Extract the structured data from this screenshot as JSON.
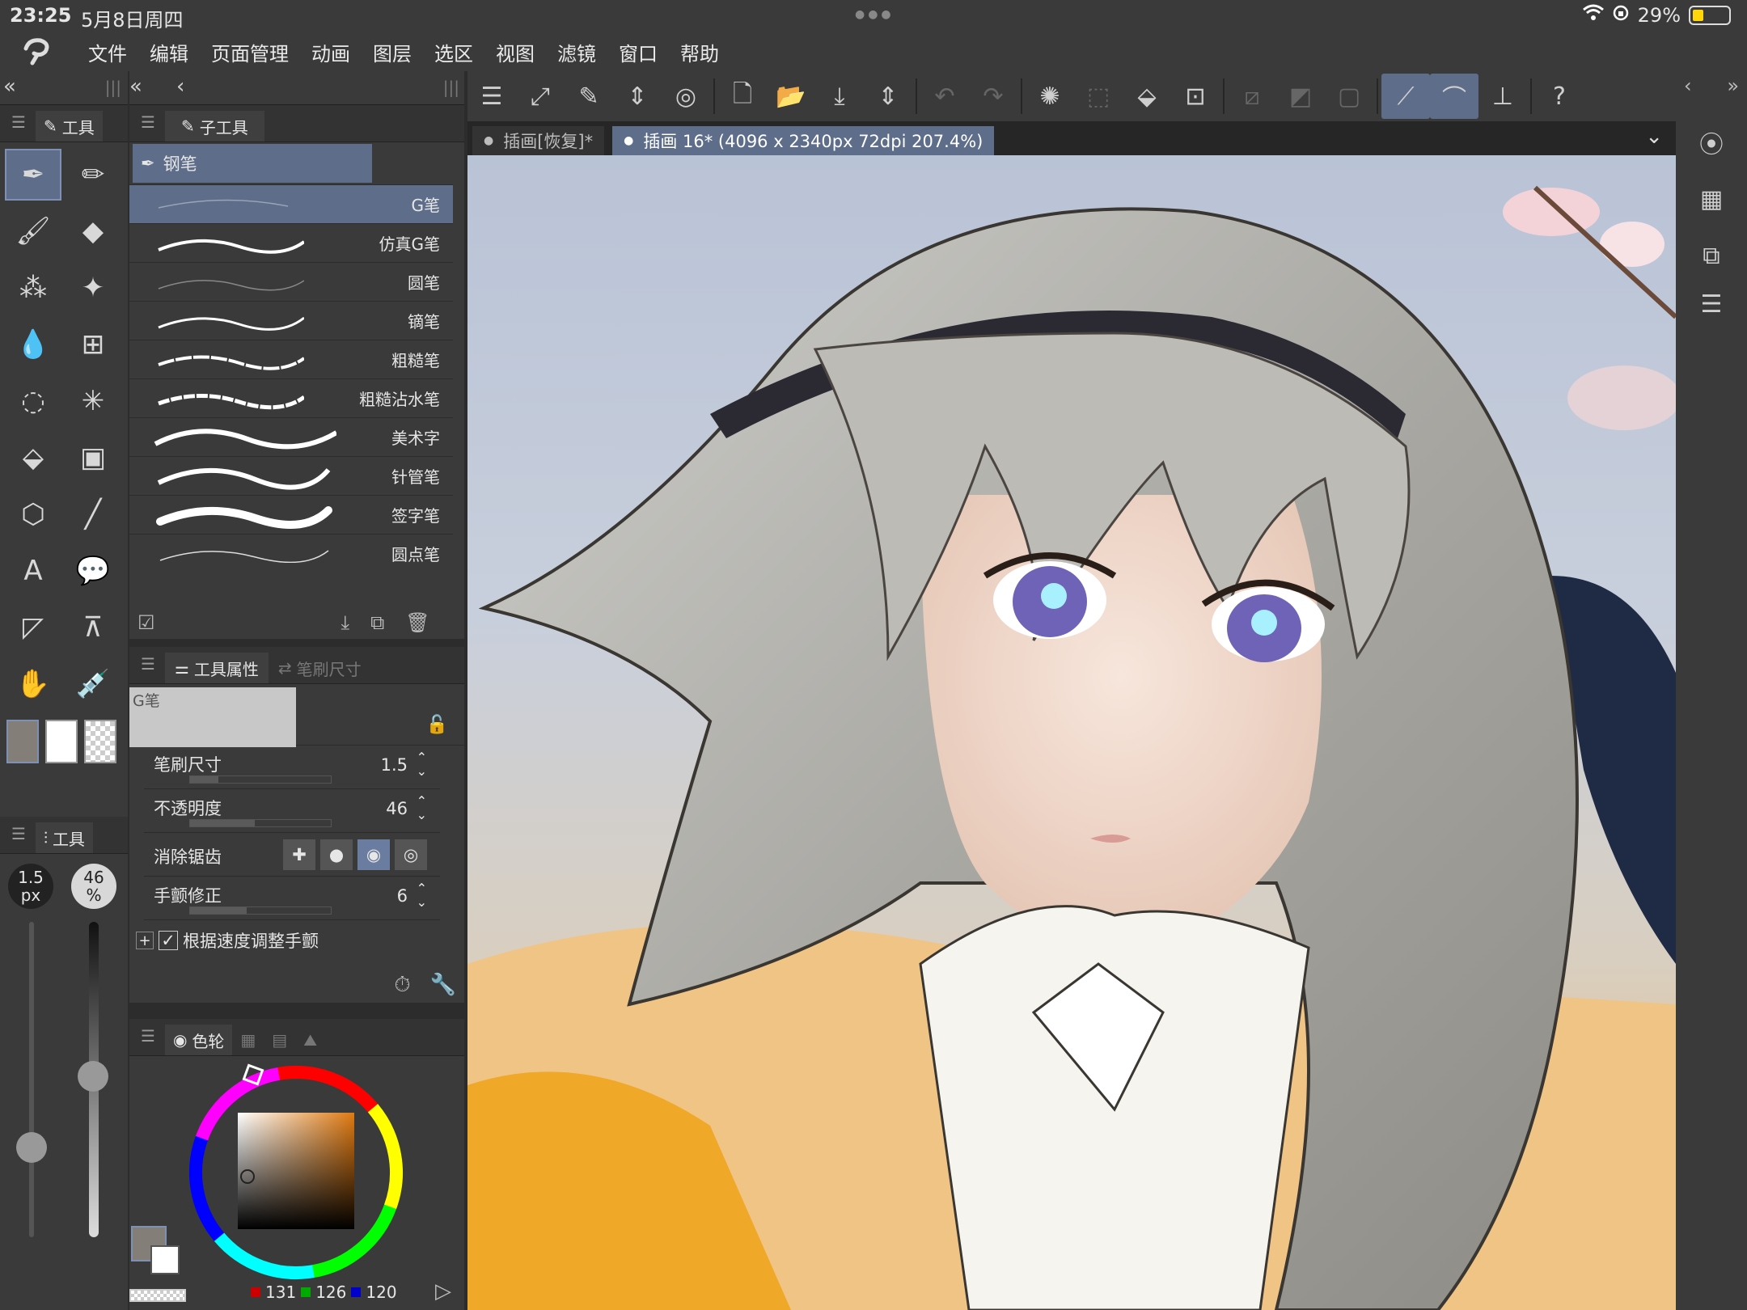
{
  "status": {
    "time": "23:25",
    "date": "5月8日周四",
    "battery": "29%"
  },
  "menu": [
    "文件",
    "编辑",
    "页面管理",
    "动画",
    "图层",
    "选区",
    "视图",
    "滤镜",
    "窗口",
    "帮助"
  ],
  "tool_panel": {
    "title": "工具"
  },
  "subtool_panel": {
    "title": "子工具",
    "group": "钢笔",
    "brushes": [
      "G笔",
      "仿真G笔",
      "圆笔",
      "镝笔",
      "粗糙笔",
      "粗糙沾水笔",
      "美术字",
      "针管笔",
      "签字笔",
      "圆点笔"
    ],
    "selected": "G笔"
  },
  "props": {
    "tab_active": "工具属性",
    "tab_inactive": "笔刷尺寸",
    "preview_label": "G笔",
    "brush_size": {
      "label": "笔刷尺寸",
      "value": "1.5",
      "level": 0.2
    },
    "opacity": {
      "label": "不透明度",
      "value": "46",
      "level": 0.46
    },
    "antialias": {
      "label": "消除锯齿"
    },
    "stabilizer": {
      "label": "手颤修正",
      "value": "6",
      "level": 0.4
    },
    "speed_check": "根据速度调整手颤"
  },
  "mini_panel": {
    "title": "工具",
    "size_value": "1.5",
    "size_unit": "px",
    "opacity_value": "46",
    "opacity_unit": "%"
  },
  "color_panel": {
    "title": "色轮",
    "r": "131",
    "g": "126",
    "b": "120",
    "main_color": "#837e78"
  },
  "tabs": {
    "inactive": "插画[恢复]*",
    "active": "插画 16* (4096 x 2340px 72dpi 207.4%)"
  },
  "colors": {
    "accent": "#5d6d8a",
    "panel": "#3a3a3a",
    "dark": "#262626"
  }
}
